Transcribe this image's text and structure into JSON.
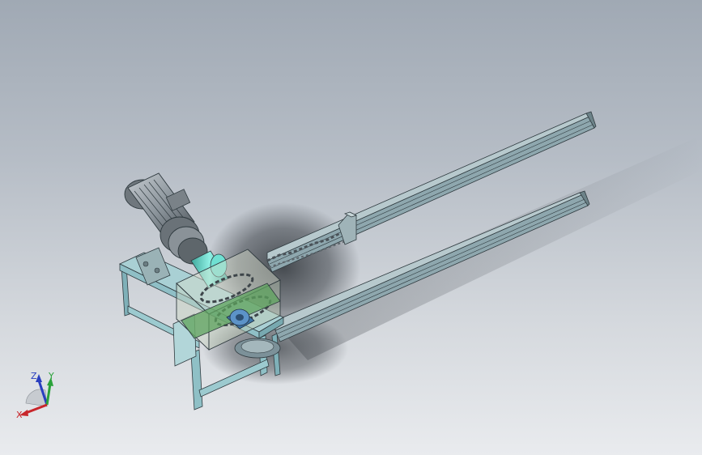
{
  "viewport": {
    "background_top": "#a0a9b4",
    "background_bottom": "#e9ebee"
  },
  "colors": {
    "frame": "#8fc0c6",
    "rail": "#7f98a0",
    "motor": "#8e979e",
    "guard": "#cfd6c8",
    "bearing": "#4a7fb0",
    "coupling": "#5fd3c4",
    "shadow": "#3a3f45"
  },
  "triad": {
    "z_label": "Z",
    "y_label": "Y",
    "x_label": "X",
    "z_color": "#2a3fbf",
    "y_color": "#2aa23a",
    "x_color": "#c8262b"
  }
}
